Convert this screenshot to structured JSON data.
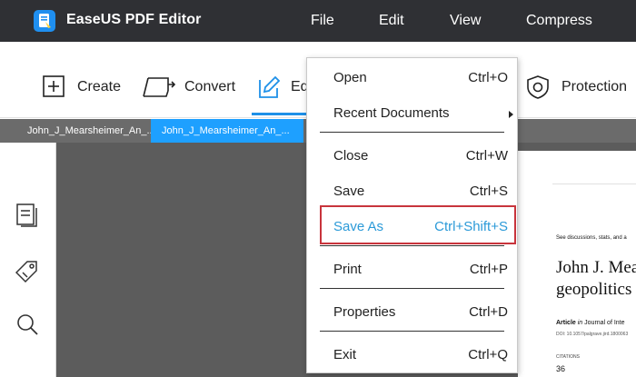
{
  "app": {
    "name": "EaseUS PDF Editor",
    "accent_color": "#1e90e8",
    "logo_icon": "easeus-pdf-logo-icon"
  },
  "menubar": {
    "items": [
      "File",
      "Edit",
      "View",
      "Compress"
    ]
  },
  "toolbar": {
    "create": {
      "label": "Create",
      "icon": "plus-square-icon"
    },
    "convert": {
      "label": "Convert",
      "icon": "convert-document-icon"
    },
    "edit": {
      "label": "Ed",
      "icon": "pencil-edit-icon",
      "active": true
    },
    "protection": {
      "label": "Protection",
      "icon": "shield-icon"
    }
  },
  "tabs": [
    {
      "label": "John_J_Mearsheimer_An_...",
      "active": false
    },
    {
      "label": "John_J_Mearsheimer_An_...",
      "active": true
    }
  ],
  "sidebar": {
    "icons": [
      "pages-icon",
      "tag-icon",
      "search-icon"
    ]
  },
  "file_menu": {
    "items": [
      {
        "label": "Open",
        "shortcut": "Ctrl+O"
      },
      {
        "label": "Recent Documents",
        "shortcut": "",
        "submenu": true
      },
      {
        "label": "Close",
        "shortcut": "Ctrl+W"
      },
      {
        "label": "Save",
        "shortcut": "Ctrl+S"
      },
      {
        "label": "Save As",
        "shortcut": "Ctrl+Shift+S",
        "highlighted": true
      },
      {
        "label": "Print",
        "shortcut": "Ctrl+P"
      },
      {
        "label": "Properties",
        "shortcut": "Ctrl+D"
      },
      {
        "label": "Exit",
        "shortcut": "Ctrl+Q"
      }
    ],
    "highlight_color": "#2b9ad8",
    "highlight_border_color": "#c8343c"
  },
  "document": {
    "discussion_line": "See discussions, stats, and a",
    "title_line_1": "John J. Mea",
    "title_line_2": "geopolitics",
    "article_label": "Article",
    "article_in": "in",
    "journal": "Journal of Inte",
    "doi": "DOI: 10.1057/palgrave.jird.1800063",
    "citations_label": "CITATIONS",
    "citations_value": "36"
  }
}
